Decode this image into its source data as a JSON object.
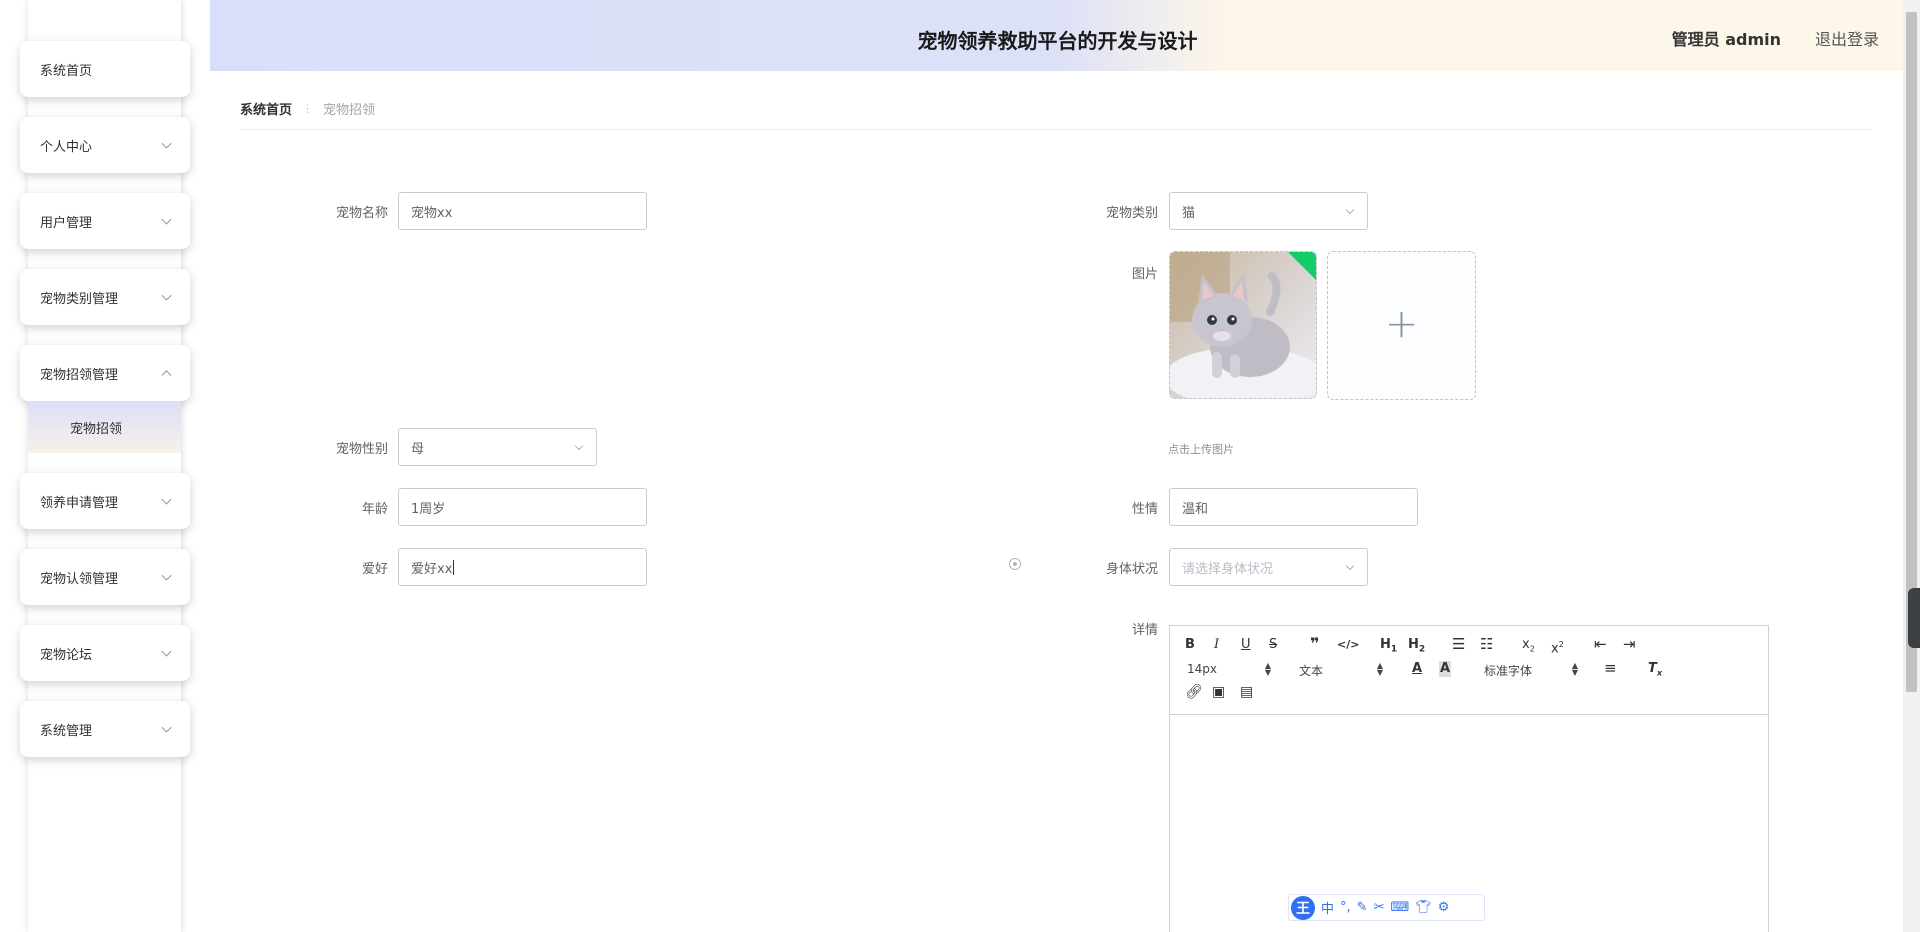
{
  "header": {
    "title": "宠物领养救助平台的开发与设计",
    "user": "管理员 admin",
    "logout": "退出登录"
  },
  "sidebar": {
    "items": [
      {
        "label": "系统首页",
        "chevron": "none"
      },
      {
        "label": "个人中心",
        "chevron": "down"
      },
      {
        "label": "用户管理",
        "chevron": "down"
      },
      {
        "label": "宠物类别管理",
        "chevron": "down"
      },
      {
        "label": "宠物招领管理",
        "chevron": "up"
      },
      {
        "label": "领养申请管理",
        "chevron": "down"
      },
      {
        "label": "宠物认领管理",
        "chevron": "down"
      },
      {
        "label": "宠物论坛",
        "chevron": "down"
      },
      {
        "label": "系统管理",
        "chevron": "down"
      }
    ],
    "active_submenu": "宠物招领"
  },
  "breadcrumb": {
    "home": "系统首页",
    "current": "宠物招领"
  },
  "form": {
    "pet_name": {
      "label": "宠物名称",
      "value": "宠物xx"
    },
    "pet_category": {
      "label": "宠物类别",
      "value": "猫"
    },
    "image": {
      "label": "图片",
      "tip": "点击上传图片"
    },
    "pet_gender": {
      "label": "宠物性别",
      "value": "母"
    },
    "age": {
      "label": "年龄",
      "value": "1周岁"
    },
    "temperament": {
      "label": "性情",
      "value": "温和"
    },
    "hobby": {
      "label": "爱好",
      "value": "爱好xx"
    },
    "health": {
      "label": "身体状况",
      "placeholder": "请选择身体状况"
    },
    "detail": {
      "label": "详情"
    }
  },
  "editor": {
    "font_size": "14px",
    "block_type": "文本",
    "font_family": "标准字体"
  },
  "ime": {
    "logo": "王",
    "mode": "中"
  },
  "colors": {
    "header_gradient_left": "#d9dffa",
    "header_gradient_right": "#fdf7ea",
    "ime_blue": "#2f6ff0",
    "upload_badge": "#13ce66"
  }
}
